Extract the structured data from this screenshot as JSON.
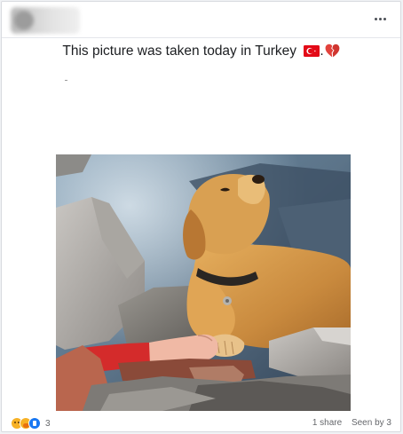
{
  "post": {
    "text": "This picture was taken today in Turkey",
    "text_suffix": ".",
    "flag_icon": "turkey-flag-emoji",
    "heart_icon": "broken-heart-emoji",
    "more_icon": "more-horizontal-icon"
  },
  "footer": {
    "reaction_icons": [
      "sad-reaction-icon",
      "care-reaction-icon",
      "like-reaction-icon"
    ],
    "reaction_count": "3",
    "shares": "1 share",
    "seen": "Seen by 3"
  },
  "colors": {
    "text": "#1c1e21",
    "secondary_text": "#65676b",
    "like_blue": "#1877f2",
    "flag_red": "#e30a17",
    "heart_red": "#e2423c"
  }
}
